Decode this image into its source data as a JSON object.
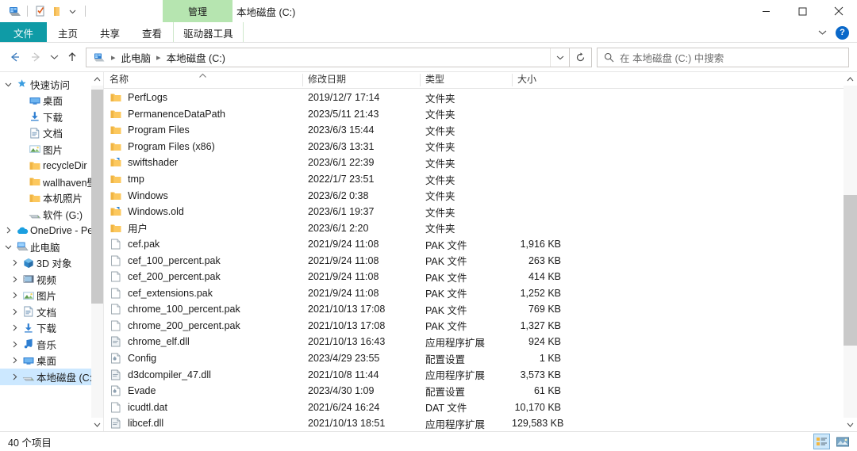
{
  "window": {
    "title": "本地磁盘 (C:)",
    "controls": {
      "minimize": "minimize-button",
      "maximize": "maximize-button",
      "close": "close-button"
    }
  },
  "quick_access_toolbar": {
    "items": [
      {
        "name": "drive-icon",
        "label": "本地磁盘"
      },
      {
        "name": "properties-icon",
        "label": "属性"
      },
      {
        "name": "new-folder-icon",
        "label": "新建文件夹"
      },
      {
        "name": "customize-dropdown-icon",
        "label": "自定义快速访问工具栏"
      }
    ]
  },
  "ribbon": {
    "contextual_group": "管理",
    "tabs": [
      {
        "label": "文件",
        "active": true,
        "contextual": false
      },
      {
        "label": "主页",
        "active": false,
        "contextual": false
      },
      {
        "label": "共享",
        "active": false,
        "contextual": false
      },
      {
        "label": "查看",
        "active": false,
        "contextual": false
      },
      {
        "label": "驱动器工具",
        "active": false,
        "contextual": true
      }
    ],
    "collapse_label": "展开功能区",
    "help_label": "?"
  },
  "navigation": {
    "back": "后退",
    "forward": "前进",
    "recent": "最近使用的位置",
    "up": "上移到",
    "refresh": "刷新",
    "breadcrumbs": [
      "此电脑",
      "本地磁盘 (C:)"
    ]
  },
  "search": {
    "placeholder": "在 本地磁盘 (C:) 中搜索",
    "value": ""
  },
  "sidebar": {
    "items": [
      {
        "label": "快速访问",
        "icon": "star-icon",
        "indent": 0,
        "twisty": "expanded",
        "pinned": false
      },
      {
        "label": "桌面",
        "icon": "desktop-icon",
        "indent": 1,
        "twisty": "none",
        "pinned": true
      },
      {
        "label": "下载",
        "icon": "download-icon",
        "indent": 1,
        "twisty": "none",
        "pinned": true
      },
      {
        "label": "文档",
        "icon": "document-icon",
        "indent": 1,
        "twisty": "none",
        "pinned": true
      },
      {
        "label": "图片",
        "icon": "pictures-icon",
        "indent": 1,
        "twisty": "none",
        "pinned": true
      },
      {
        "label": "recycleDir",
        "icon": "folder-icon",
        "indent": 1,
        "twisty": "none",
        "pinned": false
      },
      {
        "label": "wallhaven壁纸",
        "icon": "folder-icon",
        "indent": 1,
        "twisty": "none",
        "pinned": false
      },
      {
        "label": "本机照片",
        "icon": "folder-icon",
        "indent": 1,
        "twisty": "none",
        "pinned": false
      },
      {
        "label": "软件 (G:)",
        "icon": "drive-icon",
        "indent": 1,
        "twisty": "none",
        "pinned": false
      },
      {
        "label": "OneDrive - Persc",
        "icon": "onedrive-icon",
        "indent": 0,
        "twisty": "collapsed",
        "pinned": false
      },
      {
        "label": "此电脑",
        "icon": "pc-icon",
        "indent": 0,
        "twisty": "expanded",
        "pinned": false
      },
      {
        "label": "3D 对象",
        "icon": "3dobjects-icon",
        "indent": 1,
        "twisty": "collapsed",
        "pinned": false
      },
      {
        "label": "视频",
        "icon": "videos-icon",
        "indent": 1,
        "twisty": "collapsed",
        "pinned": false
      },
      {
        "label": "图片",
        "icon": "pictures-icon",
        "indent": 1,
        "twisty": "collapsed",
        "pinned": false
      },
      {
        "label": "文档",
        "icon": "document-icon",
        "indent": 1,
        "twisty": "collapsed",
        "pinned": false
      },
      {
        "label": "下载",
        "icon": "download-icon",
        "indent": 1,
        "twisty": "collapsed",
        "pinned": false
      },
      {
        "label": "音乐",
        "icon": "music-icon",
        "indent": 1,
        "twisty": "collapsed",
        "pinned": false
      },
      {
        "label": "桌面",
        "icon": "desktop-icon",
        "indent": 1,
        "twisty": "collapsed",
        "pinned": false
      },
      {
        "label": "本地磁盘 (C:)",
        "icon": "drive-icon",
        "indent": 1,
        "twisty": "collapsed",
        "pinned": false,
        "selected": true
      }
    ]
  },
  "file_list": {
    "columns": [
      {
        "key": "name",
        "label": "名称",
        "sorted": "asc"
      },
      {
        "key": "date",
        "label": "修改日期",
        "sorted": ""
      },
      {
        "key": "type",
        "label": "类型",
        "sorted": ""
      },
      {
        "key": "size",
        "label": "大小",
        "sorted": ""
      }
    ],
    "rows": [
      {
        "icon": "folder-icon",
        "name": "PerfLogs",
        "date": "2019/12/7 17:14",
        "type": "文件夹",
        "size": ""
      },
      {
        "icon": "folder-icon",
        "name": "PermanenceDataPath",
        "date": "2023/5/11 21:43",
        "type": "文件夹",
        "size": ""
      },
      {
        "icon": "folder-icon",
        "name": "Program Files",
        "date": "2023/6/3 15:44",
        "type": "文件夹",
        "size": ""
      },
      {
        "icon": "folder-icon",
        "name": "Program Files (x86)",
        "date": "2023/6/3 13:31",
        "type": "文件夹",
        "size": ""
      },
      {
        "icon": "folder-link-icon",
        "name": "swiftshader",
        "date": "2023/6/1 22:39",
        "type": "文件夹",
        "size": ""
      },
      {
        "icon": "folder-icon",
        "name": "tmp",
        "date": "2022/1/7 23:51",
        "type": "文件夹",
        "size": ""
      },
      {
        "icon": "folder-icon",
        "name": "Windows",
        "date": "2023/6/2 0:38",
        "type": "文件夹",
        "size": ""
      },
      {
        "icon": "folder-link-icon",
        "name": "Windows.old",
        "date": "2023/6/1 19:37",
        "type": "文件夹",
        "size": ""
      },
      {
        "icon": "folder-icon",
        "name": "用户",
        "date": "2023/6/1 2:20",
        "type": "文件夹",
        "size": ""
      },
      {
        "icon": "file-icon",
        "name": "cef.pak",
        "date": "2021/9/24 11:08",
        "type": "PAK 文件",
        "size": "1,916 KB"
      },
      {
        "icon": "file-icon",
        "name": "cef_100_percent.pak",
        "date": "2021/9/24 11:08",
        "type": "PAK 文件",
        "size": "263 KB"
      },
      {
        "icon": "file-icon",
        "name": "cef_200_percent.pak",
        "date": "2021/9/24 11:08",
        "type": "PAK 文件",
        "size": "414 KB"
      },
      {
        "icon": "file-icon",
        "name": "cef_extensions.pak",
        "date": "2021/9/24 11:08",
        "type": "PAK 文件",
        "size": "1,252 KB"
      },
      {
        "icon": "file-icon",
        "name": "chrome_100_percent.pak",
        "date": "2021/10/13 17:08",
        "type": "PAK 文件",
        "size": "769 KB"
      },
      {
        "icon": "file-icon",
        "name": "chrome_200_percent.pak",
        "date": "2021/10/13 17:08",
        "type": "PAK 文件",
        "size": "1,327 KB"
      },
      {
        "icon": "dll-icon",
        "name": "chrome_elf.dll",
        "date": "2021/10/13 16:43",
        "type": "应用程序扩展",
        "size": "924 KB"
      },
      {
        "icon": "config-icon",
        "name": "Config",
        "date": "2023/4/29 23:55",
        "type": "配置设置",
        "size": "1 KB"
      },
      {
        "icon": "dll-icon",
        "name": "d3dcompiler_47.dll",
        "date": "2021/10/8 11:44",
        "type": "应用程序扩展",
        "size": "3,573 KB"
      },
      {
        "icon": "config-icon",
        "name": "Evade",
        "date": "2023/4/30 1:09",
        "type": "配置设置",
        "size": "61 KB"
      },
      {
        "icon": "file-icon",
        "name": "icudtl.dat",
        "date": "2021/6/24 16:24",
        "type": "DAT 文件",
        "size": "10,170 KB"
      },
      {
        "icon": "dll-icon",
        "name": "libcef.dll",
        "date": "2021/10/13 18:51",
        "type": "应用程序扩展",
        "size": "129,583 KB"
      }
    ]
  },
  "status_bar": {
    "item_count": "40 个项目",
    "views": [
      {
        "name": "details-view-button",
        "label": "详细信息",
        "active": true
      },
      {
        "name": "large-icons-view-button",
        "label": "大图标",
        "active": false
      }
    ]
  },
  "colors": {
    "file_tab": "#0f9ba6",
    "contextual_group": "#b6e5b0",
    "selection": "#cce8ff",
    "folder": "#ffd166",
    "help_blue": "#0a68c9"
  }
}
